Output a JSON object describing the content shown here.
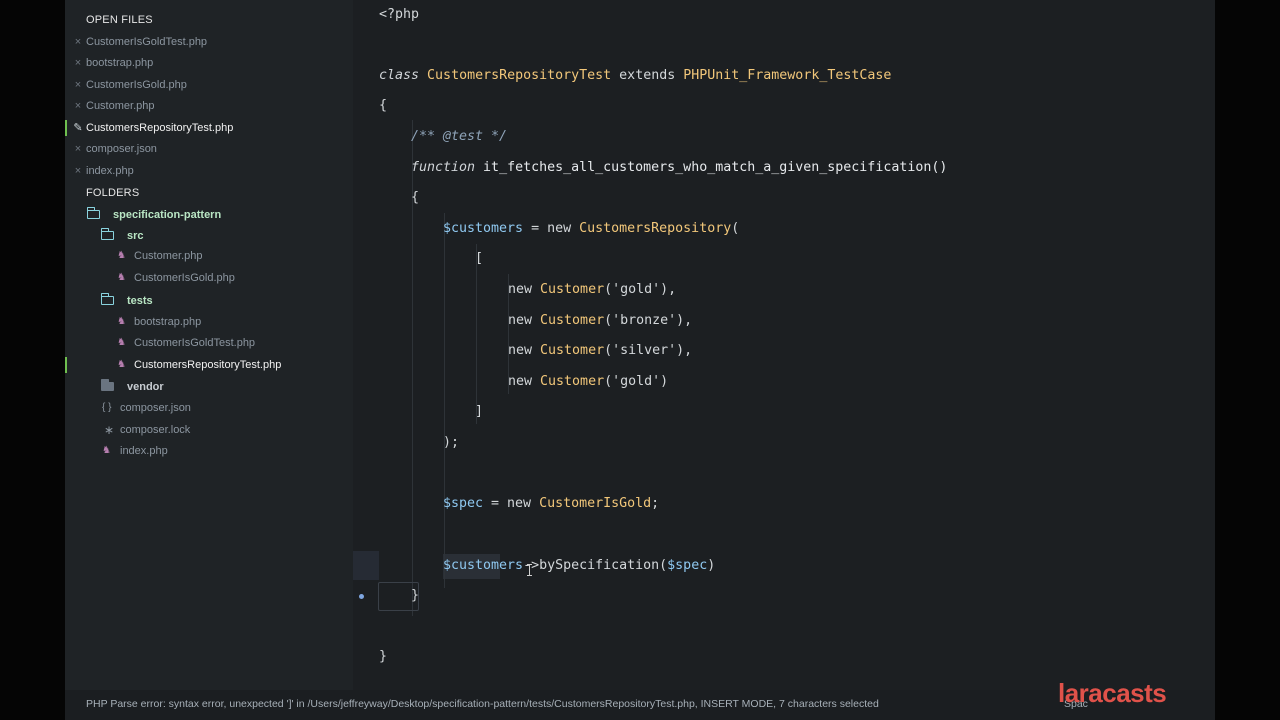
{
  "sidebar": {
    "open_files_header": "OPEN FILES",
    "open_files": [
      {
        "name": "CustomerIsGoldTest.php",
        "glyph": "×",
        "active": false
      },
      {
        "name": "bootstrap.php",
        "glyph": "×",
        "active": false
      },
      {
        "name": "CustomerIsGold.php",
        "glyph": "×",
        "active": false
      },
      {
        "name": "Customer.php",
        "glyph": "×",
        "active": false
      },
      {
        "name": "CustomersRepositoryTest.php",
        "glyph": "pencil-icon",
        "active": true
      },
      {
        "name": "composer.json",
        "glyph": "×",
        "active": false
      },
      {
        "name": "index.php",
        "glyph": "×",
        "active": false
      }
    ],
    "folders_header": "FOLDERS",
    "tree": {
      "root": "specification-pattern",
      "src": "src",
      "src_files": [
        "Customer.php",
        "CustomerIsGold.php"
      ],
      "tests": "tests",
      "tests_files": [
        "bootstrap.php",
        "CustomerIsGoldTest.php",
        "CustomersRepositoryTest.php"
      ],
      "vendor": "vendor",
      "root_files": [
        "composer.json",
        "composer.lock",
        "index.php"
      ]
    }
  },
  "editor": {
    "file": "CustomersRepositoryTest.php",
    "code": {
      "l1": "<?php",
      "class_kw": "class",
      "class_name": "CustomersRepositoryTest",
      "extends_kw": " extends ",
      "parent": "PHPUnit_Framework_TestCase",
      "brace_open": "{",
      "docblock": "/** @test */",
      "function_kw": "function",
      "function_name": " it_fetches_all_customers_who_match_a_given_specification()",
      "inner_brace_open": "{",
      "customers_var": "$customers",
      "assign_new": " = new ",
      "repo_class": "CustomersRepository",
      "paren_open": "(",
      "bracket_open": "[",
      "new_kw": "new ",
      "customer_class": "Customer",
      "args": [
        "('gold'),",
        "('bronze'),",
        "('silver'),",
        "('gold')"
      ],
      "bracket_close": "]",
      "paren_close": ");",
      "spec_var": "$spec",
      "spec_class": "CustomerIsGold",
      "semicolon": ";",
      "call_method": "->bySpecification(",
      "call_close": ")",
      "inner_brace_close": "}",
      "brace_close": "}"
    }
  },
  "status": {
    "message": "PHP Parse error:  syntax error, unexpected ']' in /Users/jeffreyway/Desktop/specification-pattern/tests/CustomersRepositoryTest.php, INSERT MODE, 7 characters selected",
    "right": "Spac"
  },
  "watermark": "laracasts",
  "colors": {
    "sidebar_bg": "#1f2326",
    "editor_bg": "#1c1f22",
    "class_color": "#f2c77a",
    "variable_color": "#8fc8f0",
    "watermark_color": "#e0524a",
    "active_marker": "#6fbf4f"
  }
}
